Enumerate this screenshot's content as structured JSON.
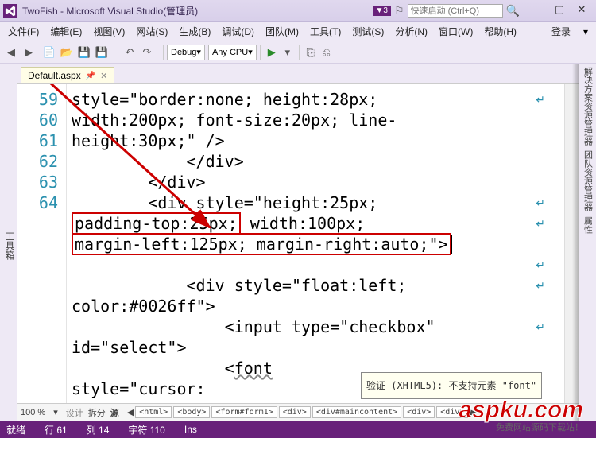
{
  "title": "TwoFish - Microsoft Visual Studio(管理员)",
  "quicklaunch": {
    "placeholder": "快速启动 (Ctrl+Q)"
  },
  "badge_v": "▼3",
  "login_label": "登录",
  "menus": [
    "文件(F)",
    "编辑(E)",
    "视图(V)",
    "网站(S)",
    "生成(B)",
    "调试(D)",
    "团队(M)",
    "工具(T)",
    "测试(S)",
    "分析(N)",
    "窗口(W)",
    "帮助(H)"
  ],
  "toolbar": {
    "config": "Debug",
    "platform": "Any CPU"
  },
  "left_tab": "工具箱",
  "right_tabs": [
    "解决方案资源管理器",
    "团队资源管理器",
    "属性"
  ],
  "tab_name": "Default.aspx",
  "zoom": "100 %",
  "views": {
    "design": "设计",
    "split": "拆分",
    "source": "源"
  },
  "breadcrumbs": [
    "<html>",
    "<body>",
    "<form#form1>",
    "<div>",
    "<div#maincontent>",
    "<div>",
    "<div>"
  ],
  "status": {
    "ready": "就绪",
    "line": "行 61",
    "col": "列 14",
    "ch": "字符 110",
    "ins": "Ins"
  },
  "code": {
    "l58a": "style=\"border:none; height:28px;",
    "l58b": "width:200px; font-size:20px; line-",
    "l58c": "height:30px;\" />",
    "l59": "            </div>",
    "l60": "        </div>",
    "l61a": "        <div style=\"height:25px;",
    "box1": "padding-top:25px;",
    "l61b": " width:100px;",
    "box2": "margin-left:125px; margin-right:auto;\">",
    "l62a": "            <div style=\"float:left;",
    "l62b": "color:#0026ff\">",
    "l63a": "                <input type=\"checkbox\"",
    "l63b": "id=\"select\">",
    "l64": "                <font",
    "l65": "style=\"cursor:"
  },
  "gutter": [
    "",
    "",
    "",
    "59",
    "60",
    "61",
    "",
    "",
    "",
    "62",
    "",
    "63",
    "",
    "64",
    ""
  ],
  "tooltip": "验证 (XHTML5): 不支持元素 \"font\"",
  "watermark": {
    "logo": "aspku.com",
    "sub": "免费网站源码下载站！"
  }
}
